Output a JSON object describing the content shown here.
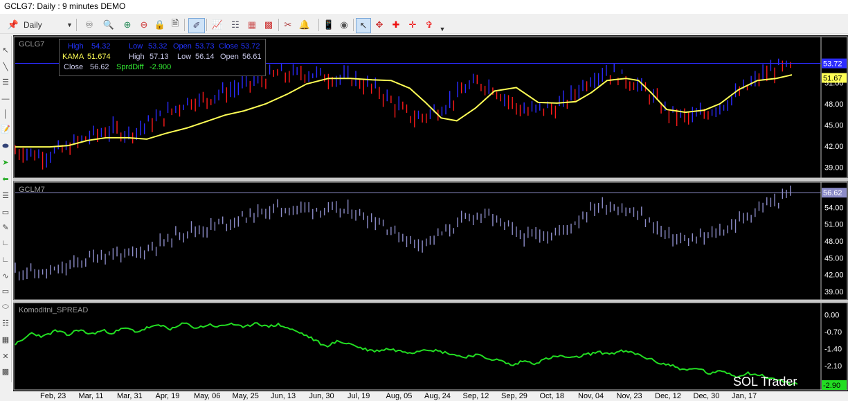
{
  "window": {
    "title": "GCLG7: Daily : 9 minutes DEMO"
  },
  "toolbar": {
    "period": "Daily"
  },
  "colors": {
    "up_bar": "#2b2bff",
    "down_bar": "#ff1a1a",
    "kama": "#ffff55",
    "gclm_bar": "#8c8cc8",
    "spread": "#22dd22",
    "background": "#000000",
    "axis_text": "#ffffff"
  },
  "icons": [
    "pin-icon",
    "chart-type-icon",
    "magnifier-icon",
    "zoom-in-icon",
    "zoom-out-icon",
    "lock-icon",
    "page-icon",
    "draw-pen-icon",
    "indicator-icon",
    "tree-icon",
    "bars-icon",
    "scissors-icon",
    "bell-icon",
    "phone-icon",
    "mouse-icon",
    "cursor-icon",
    "crosshair-icon",
    "crosshair-red-icon",
    "crosshair-red-bold-icon",
    "crosshair-red-arrow-icon"
  ],
  "infobox": {
    "row1": {
      "high_label": "High",
      "high": "54.32",
      "low_label": "Low",
      "low": "53.32",
      "open_label": "Open",
      "open": "53.73",
      "close_label": "Close",
      "close": "53.72"
    },
    "row2": {
      "kama_label": "KAMA",
      "kama": "51.674",
      "high_label": "High",
      "high": "57.13",
      "low_label": "Low",
      "low": "56.14",
      "open_label": "Open",
      "open": "56.61"
    },
    "row3": {
      "close_label": "Close",
      "close": "56.62",
      "spread_label": "SprdDiff",
      "spread": "-2.900"
    }
  },
  "watermark": "SOL Trader",
  "chart_data": [
    {
      "type": "bar",
      "name": "GCLG7",
      "y_ticks": [
        "51.00",
        "48.00",
        "45.00",
        "42.00",
        "39.00"
      ],
      "ylim": [
        37.5,
        57.5
      ],
      "last_price": "53.72",
      "kama_last": "51.67",
      "kama_label_y": 51.67,
      "series_points": [
        [
          0,
          41.3
        ],
        [
          8,
          41.2
        ],
        [
          16,
          40.6
        ],
        [
          24,
          41.1
        ],
        [
          32,
          41.6
        ],
        [
          40,
          42.6
        ],
        [
          48,
          43.4
        ],
        [
          56,
          44.0
        ],
        [
          64,
          44.3
        ],
        [
          72,
          43.8
        ],
        [
          80,
          44.5
        ],
        [
          88,
          45.6
        ],
        [
          96,
          46.4
        ],
        [
          104,
          47.6
        ],
        [
          112,
          48.5
        ],
        [
          120,
          48.4
        ],
        [
          128,
          49.3
        ],
        [
          136,
          49.8
        ],
        [
          144,
          50.5
        ],
        [
          152,
          51.1
        ],
        [
          160,
          51.6
        ],
        [
          168,
          52.3
        ],
        [
          176,
          52.0
        ],
        [
          184,
          52.4
        ],
        [
          192,
          52.2
        ],
        [
          200,
          51.8
        ],
        [
          208,
          51.6
        ],
        [
          216,
          51.6
        ],
        [
          224,
          50.6
        ],
        [
          232,
          49.9
        ],
        [
          240,
          48.3
        ],
        [
          248,
          46.9
        ],
        [
          256,
          45.9
        ],
        [
          264,
          46.5
        ],
        [
          272,
          47.4
        ],
        [
          280,
          48.7
        ],
        [
          288,
          50.3
        ],
        [
          296,
          50.9
        ],
        [
          304,
          50.5
        ],
        [
          312,
          49.0
        ],
        [
          320,
          47.6
        ],
        [
          328,
          46.8
        ],
        [
          336,
          47.4
        ],
        [
          344,
          47.3
        ],
        [
          352,
          48.3
        ],
        [
          360,
          50.1
        ],
        [
          368,
          51.7
        ],
        [
          376,
          52.6
        ],
        [
          384,
          52.1
        ],
        [
          392,
          51.3
        ],
        [
          400,
          50.3
        ],
        [
          408,
          48.7
        ],
        [
          416,
          47.0
        ],
        [
          424,
          46.3
        ],
        [
          432,
          46.0
        ],
        [
          440,
          46.6
        ],
        [
          448,
          47.5
        ],
        [
          456,
          48.4
        ],
        [
          464,
          49.8
        ],
        [
          472,
          51.1
        ],
        [
          480,
          52.4
        ],
        [
          488,
          53.1
        ],
        [
          496,
          53.0
        ]
      ],
      "kama_points": [
        [
          0,
          41.9
        ],
        [
          22,
          41.9
        ],
        [
          34,
          42.1
        ],
        [
          46,
          42.8
        ],
        [
          58,
          43.2
        ],
        [
          72,
          43.2
        ],
        [
          84,
          43.0
        ],
        [
          96,
          43.8
        ],
        [
          110,
          44.6
        ],
        [
          122,
          45.5
        ],
        [
          134,
          46.4
        ],
        [
          146,
          47.0
        ],
        [
          160,
          48.0
        ],
        [
          174,
          49.4
        ],
        [
          186,
          50.8
        ],
        [
          200,
          51.6
        ],
        [
          214,
          51.6
        ],
        [
          228,
          51.4
        ],
        [
          240,
          51.3
        ],
        [
          252,
          50.2
        ],
        [
          262,
          48.2
        ],
        [
          272,
          46.0
        ],
        [
          282,
          45.6
        ],
        [
          294,
          47.4
        ],
        [
          306,
          49.8
        ],
        [
          320,
          50.3
        ],
        [
          334,
          48.2
        ],
        [
          346,
          48.1
        ],
        [
          358,
          48.3
        ],
        [
          368,
          49.6
        ],
        [
          378,
          51.3
        ],
        [
          390,
          51.6
        ],
        [
          398,
          51.3
        ],
        [
          406,
          49.6
        ],
        [
          416,
          47.2
        ],
        [
          428,
          46.8
        ],
        [
          440,
          47.1
        ],
        [
          450,
          48.0
        ],
        [
          462,
          50.0
        ],
        [
          474,
          51.3
        ],
        [
          486,
          51.6
        ],
        [
          496,
          52.1
        ]
      ]
    },
    {
      "type": "bar",
      "name": "GCLM7",
      "y_ticks": [
        "57.00",
        "54.00",
        "51.00",
        "48.00",
        "45.00",
        "42.00",
        "39.00"
      ],
      "ylim": [
        37.5,
        58.5
      ],
      "last_price": "56.62",
      "series_points": [
        [
          0,
          42.7
        ],
        [
          8,
          42.6
        ],
        [
          16,
          42.1
        ],
        [
          24,
          42.5
        ],
        [
          32,
          43.1
        ],
        [
          40,
          44.1
        ],
        [
          48,
          45.0
        ],
        [
          56,
          45.6
        ],
        [
          64,
          45.8
        ],
        [
          72,
          45.3
        ],
        [
          80,
          46.0
        ],
        [
          88,
          47.1
        ],
        [
          96,
          47.9
        ],
        [
          104,
          49.2
        ],
        [
          112,
          50.1
        ],
        [
          120,
          50.0
        ],
        [
          128,
          50.9
        ],
        [
          136,
          51.4
        ],
        [
          144,
          52.1
        ],
        [
          152,
          52.7
        ],
        [
          160,
          53.2
        ],
        [
          168,
          53.9
        ],
        [
          176,
          53.6
        ],
        [
          184,
          54.0
        ],
        [
          192,
          53.8
        ],
        [
          200,
          53.4
        ],
        [
          208,
          53.3
        ],
        [
          216,
          53.3
        ],
        [
          224,
          52.3
        ],
        [
          232,
          51.6
        ],
        [
          240,
          50.0
        ],
        [
          248,
          48.6
        ],
        [
          256,
          47.6
        ],
        [
          264,
          48.2
        ],
        [
          272,
          49.2
        ],
        [
          280,
          50.5
        ],
        [
          288,
          52.1
        ],
        [
          296,
          52.7
        ],
        [
          304,
          52.3
        ],
        [
          312,
          50.8
        ],
        [
          320,
          49.4
        ],
        [
          328,
          48.6
        ],
        [
          336,
          49.3
        ],
        [
          344,
          49.2
        ],
        [
          352,
          50.2
        ],
        [
          360,
          52.0
        ],
        [
          368,
          53.7
        ],
        [
          376,
          54.5
        ],
        [
          384,
          54.1
        ],
        [
          392,
          53.3
        ],
        [
          400,
          52.3
        ],
        [
          408,
          50.7
        ],
        [
          416,
          49.0
        ],
        [
          424,
          48.3
        ],
        [
          432,
          48.0
        ],
        [
          440,
          48.6
        ],
        [
          448,
          49.5
        ],
        [
          456,
          50.4
        ],
        [
          464,
          51.9
        ],
        [
          472,
          53.2
        ],
        [
          480,
          54.5
        ],
        [
          488,
          55.2
        ],
        [
          496,
          56.6
        ]
      ]
    },
    {
      "type": "line",
      "name": "Komoditni_SPREAD",
      "y_ticks": [
        "0.00",
        "-0.70",
        "-1.40",
        "-2.10",
        "-2.80"
      ],
      "ylim": [
        -3.1,
        0.5
      ],
      "last_value": "-2.90",
      "series_points": [
        [
          0,
          -1.2
        ],
        [
          4,
          -1.1
        ],
        [
          10,
          -0.75
        ],
        [
          18,
          -0.9
        ],
        [
          26,
          -0.65
        ],
        [
          34,
          -0.85
        ],
        [
          40,
          -0.6
        ],
        [
          48,
          -0.8
        ],
        [
          56,
          -0.65
        ],
        [
          62,
          -0.75
        ],
        [
          70,
          -0.55
        ],
        [
          78,
          -0.7
        ],
        [
          86,
          -0.5
        ],
        [
          94,
          -0.45
        ],
        [
          100,
          -0.6
        ],
        [
          108,
          -0.35
        ],
        [
          116,
          -0.55
        ],
        [
          124,
          -0.4
        ],
        [
          130,
          -0.5
        ],
        [
          138,
          -0.35
        ],
        [
          146,
          -0.55
        ],
        [
          154,
          -0.3
        ],
        [
          160,
          -0.5
        ],
        [
          168,
          -0.4
        ],
        [
          176,
          -0.6
        ],
        [
          184,
          -0.8
        ],
        [
          190,
          -1.0
        ],
        [
          198,
          -1.3
        ],
        [
          206,
          -1.1
        ],
        [
          214,
          -1.2
        ],
        [
          222,
          -1.4
        ],
        [
          230,
          -1.5
        ],
        [
          238,
          -1.4
        ],
        [
          246,
          -1.5
        ],
        [
          254,
          -1.55
        ],
        [
          262,
          -1.4
        ],
        [
          270,
          -1.5
        ],
        [
          278,
          -1.6
        ],
        [
          286,
          -1.75
        ],
        [
          294,
          -1.65
        ],
        [
          302,
          -1.8
        ],
        [
          310,
          -1.9
        ],
        [
          318,
          -2.1
        ],
        [
          324,
          -1.9
        ],
        [
          332,
          -2.0
        ],
        [
          340,
          -1.8
        ],
        [
          348,
          -1.7
        ],
        [
          356,
          -1.8
        ],
        [
          364,
          -1.65
        ],
        [
          372,
          -1.55
        ],
        [
          380,
          -1.6
        ],
        [
          388,
          -1.5
        ],
        [
          396,
          -1.6
        ],
        [
          404,
          -1.8
        ],
        [
          412,
          -2.0
        ],
        [
          420,
          -2.1
        ],
        [
          428,
          -2.3
        ],
        [
          436,
          -2.2
        ],
        [
          444,
          -2.45
        ],
        [
          452,
          -2.3
        ],
        [
          460,
          -2.55
        ],
        [
          468,
          -2.4
        ],
        [
          476,
          -2.5
        ],
        [
          484,
          -2.65
        ],
        [
          492,
          -2.75
        ],
        [
          496,
          -2.9
        ],
        [
          500,
          -2.8
        ]
      ]
    }
  ],
  "date_axis": [
    "Feb, 23",
    "Mar, 11",
    "Mar, 31",
    "Apr, 19",
    "May, 06",
    "May, 25",
    "Jun, 13",
    "Jun, 30",
    "Jul, 19",
    "Aug, 05",
    "Aug, 24",
    "Sep, 12",
    "Sep, 29",
    "Oct, 18",
    "Nov, 04",
    "Nov, 23",
    "Dec, 12",
    "Dec, 30",
    "Jan, 17"
  ]
}
